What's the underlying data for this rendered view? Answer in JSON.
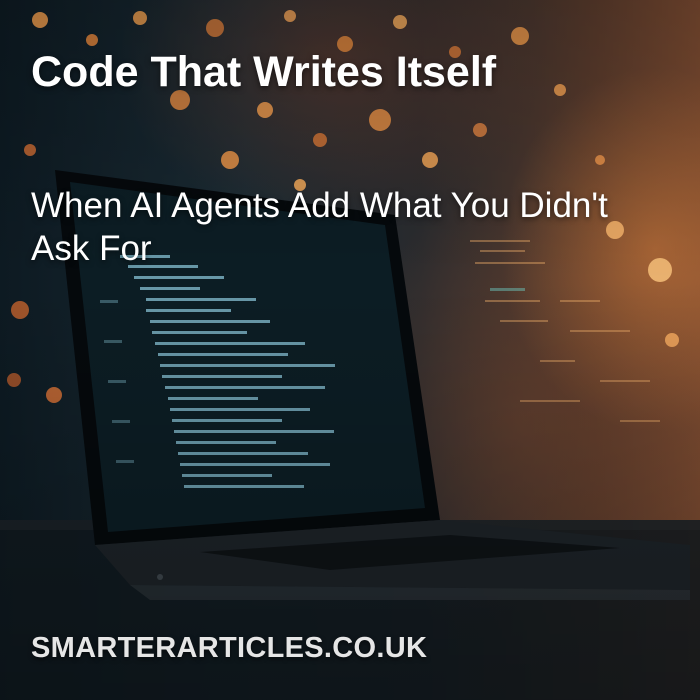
{
  "card": {
    "title": "Code That Writes Itself",
    "subtitle": "When AI Agents Add What You Didn't Ask For",
    "site": "SMARTERARTICLES.CO.UK"
  },
  "colors": {
    "text": "#ffffff",
    "site_text": "#e6e6e6",
    "code_text": "#7fb7c9",
    "bokeh": "#f39a4a"
  }
}
